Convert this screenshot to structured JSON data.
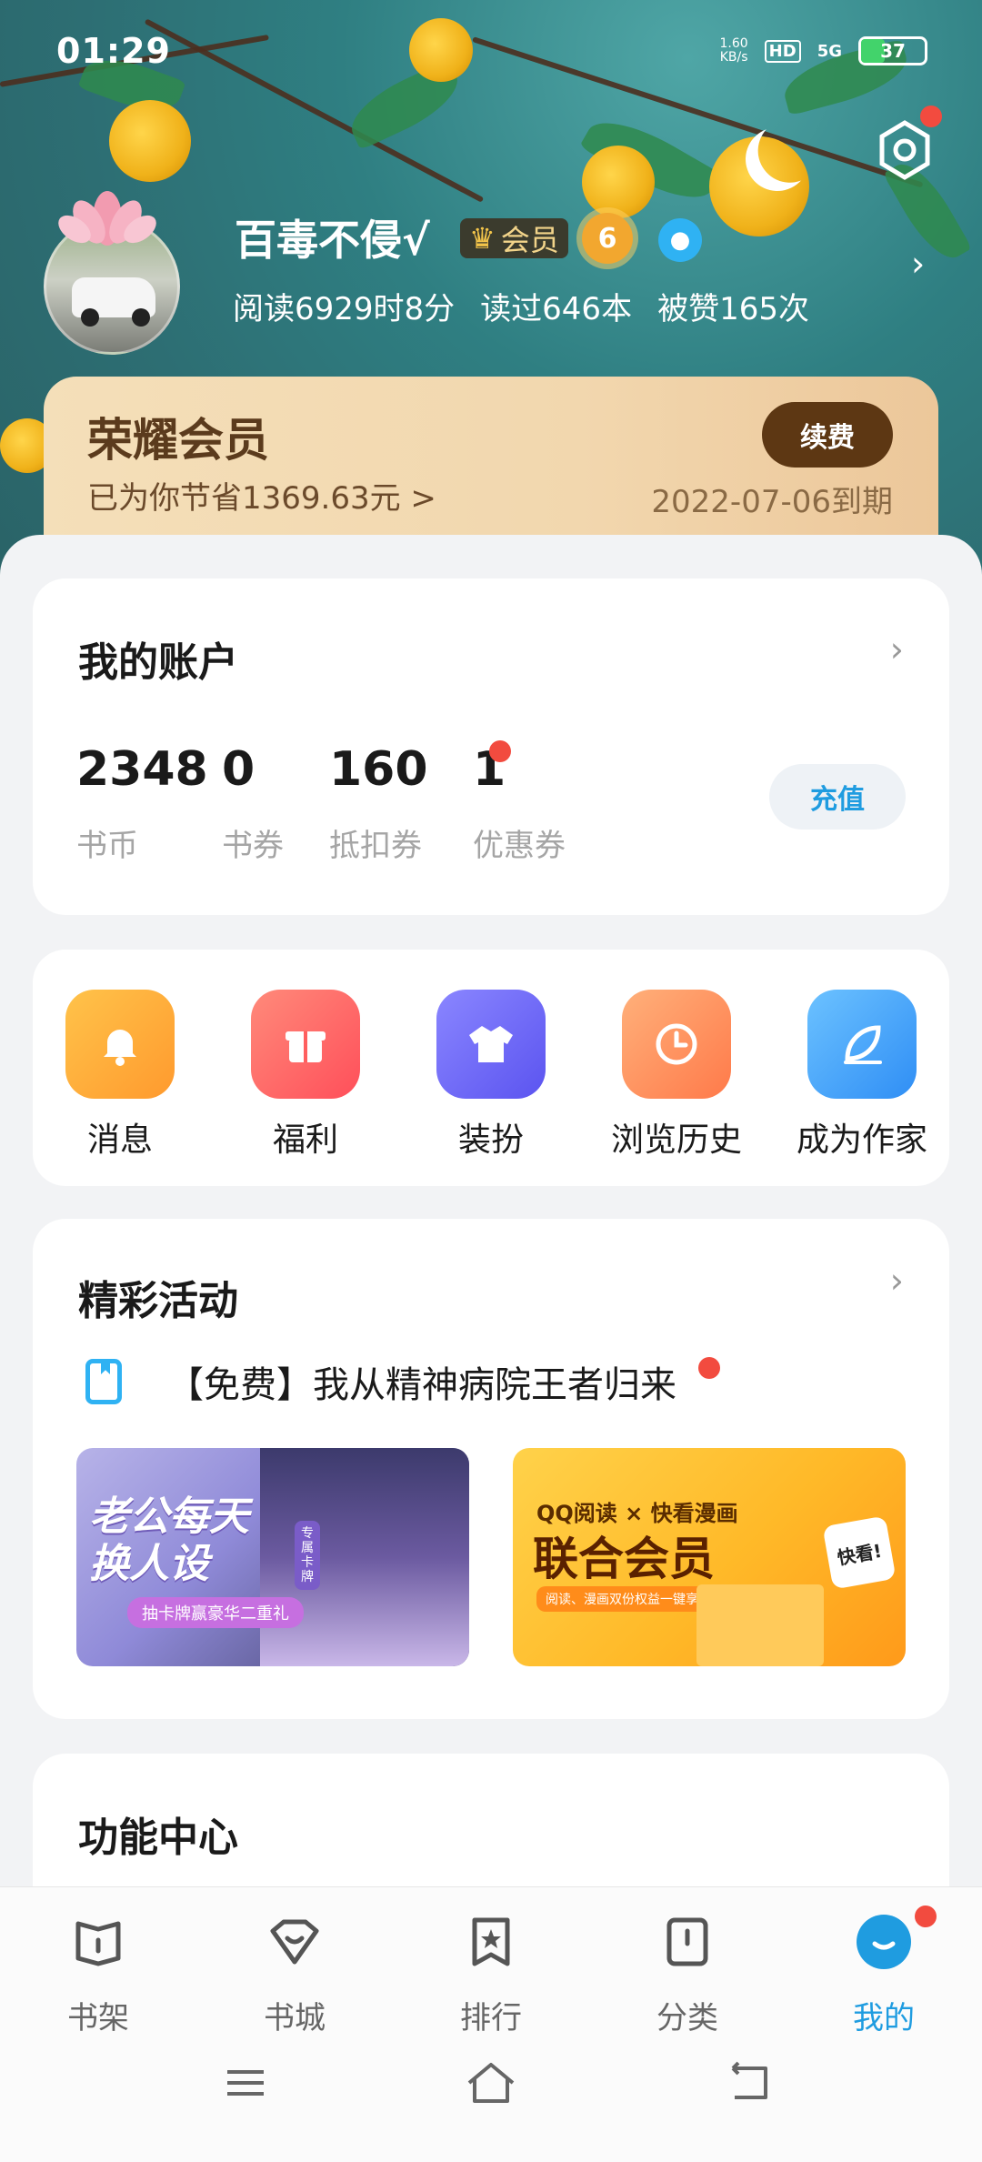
{
  "status_bar": {
    "time": "01:29",
    "net_speed": "1.60\nKB/s",
    "hd": "HD",
    "signal": "5G",
    "battery": "37"
  },
  "profile": {
    "username": "百毒不侵√",
    "vip_label": "会员",
    "level": "6",
    "stats": [
      "阅读6929时8分",
      "读过646本",
      "被赞165次"
    ]
  },
  "vip_card": {
    "title": "荣耀会员",
    "saved": "已为你节省1369.63元 >",
    "renew_label": "续费",
    "expire": "2022-07-06到期"
  },
  "account": {
    "title": "我的账户",
    "items": [
      {
        "value": "2348",
        "label": "书币"
      },
      {
        "value": "0",
        "label": "书券"
      },
      {
        "value": "160",
        "label": "抵扣券"
      },
      {
        "value": "1",
        "label": "优惠券"
      }
    ],
    "recharge_label": "充值"
  },
  "functions": [
    {
      "label": "消息",
      "icon": "bell-icon",
      "color": "#ffa52e"
    },
    {
      "label": "福利",
      "icon": "gift-icon",
      "color": "#ff5f5f"
    },
    {
      "label": "装扮",
      "icon": "shirt-icon",
      "color": "#6c68f5"
    },
    {
      "label": "浏览历史",
      "icon": "clock-icon",
      "color": "#ff8f5a"
    },
    {
      "label": "成为作家",
      "icon": "feather-icon",
      "color": "#3c9cf5"
    }
  ],
  "activities": {
    "title": "精彩活动",
    "headline": "【免费】我从精神病院王者归来",
    "banner1": {
      "title": "老公每天\n换人设",
      "tag": "抽卡牌赢豪华二重礼",
      "side": "专属卡牌"
    },
    "banner2": {
      "top": "QQ阅读 × 快看漫画",
      "main": "联合会员",
      "sub": "阅读、漫画双份权益一键享受",
      "logo": "快看!"
    }
  },
  "function_center": {
    "title": "功能中心"
  },
  "tabs": [
    {
      "label": "书架",
      "icon": "bookshelf-icon"
    },
    {
      "label": "书城",
      "icon": "bookstore-icon"
    },
    {
      "label": "排行",
      "icon": "ranking-icon"
    },
    {
      "label": "分类",
      "icon": "category-icon"
    },
    {
      "label": "我的",
      "icon": "profile-icon"
    }
  ],
  "colors": {
    "accent": "#1f9ce0",
    "vip_brown": "#5d3713",
    "badge_red": "#f24b3f"
  }
}
